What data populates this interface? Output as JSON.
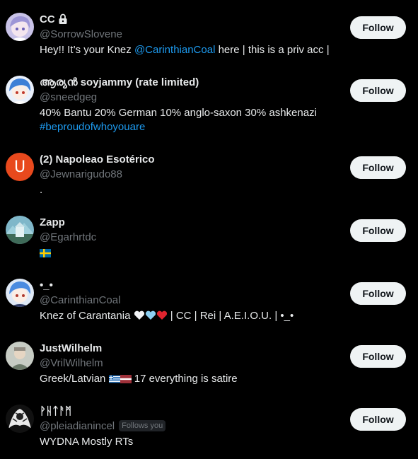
{
  "follow_label": "Follow",
  "users": [
    {
      "name": "CC",
      "locked": true,
      "handle": "@SorrowSlovene",
      "bio_pre": "Hey!! It’s your Knez ",
      "bio_mention": "@CarinthianCoal",
      "bio_post": " here | this is a priv acc |",
      "avatar": "anime-avatar-purple"
    },
    {
      "name": "ആര്യൻ soyjammy (rate limited)",
      "handle": "@sneedgeg",
      "bio_line1": "40% Bantu 20% German 10% anglo-saxon 30% ashkenazi",
      "bio_hashtag": "#beproudofwhoyouare",
      "avatar": "anime-avatar-blue"
    },
    {
      "name": "(2) Napoleao Esotérico",
      "handle": "@Jewnarigudo88",
      "bio": ".",
      "avatar_letter": "U",
      "avatar_color": "#e8491d"
    },
    {
      "name": "Zapp",
      "handle": "@Egarhrtdc",
      "bio_flag": "sweden-flag",
      "avatar": "landscape-avatar"
    },
    {
      "name": "•_•",
      "handle": "@CarinthianCoal",
      "bio_pre": "Knez of Carantania ",
      "bio_post": " | CC | Rei | A.E.I.O.U. | •_•",
      "bio_hearts": [
        "white-heart",
        "light-blue-heart",
        "red-heart"
      ],
      "avatar": "anime-avatar-blue"
    },
    {
      "name": "JustWilhelm",
      "handle": "@VrilWilhelm",
      "bio_pre": "Greek/Latvian ",
      "bio_post": " 17 everything is satire",
      "bio_flags": [
        "greece-flag",
        "latvia-flag"
      ],
      "avatar": "portrait-avatar"
    },
    {
      "name": "ᚹᚺᛏᚨᛗ",
      "handle": "@pleiadianincel",
      "follows_you": "Follows you",
      "bio": "WYDNA Mostly RTs",
      "avatar": "bw-art-avatar"
    }
  ],
  "colors": {
    "background": "#000000",
    "text": "#e7e9ea",
    "muted": "#71767b",
    "link": "#1d9bf0",
    "button_bg": "#eff3f4",
    "button_text": "#0f1419"
  }
}
